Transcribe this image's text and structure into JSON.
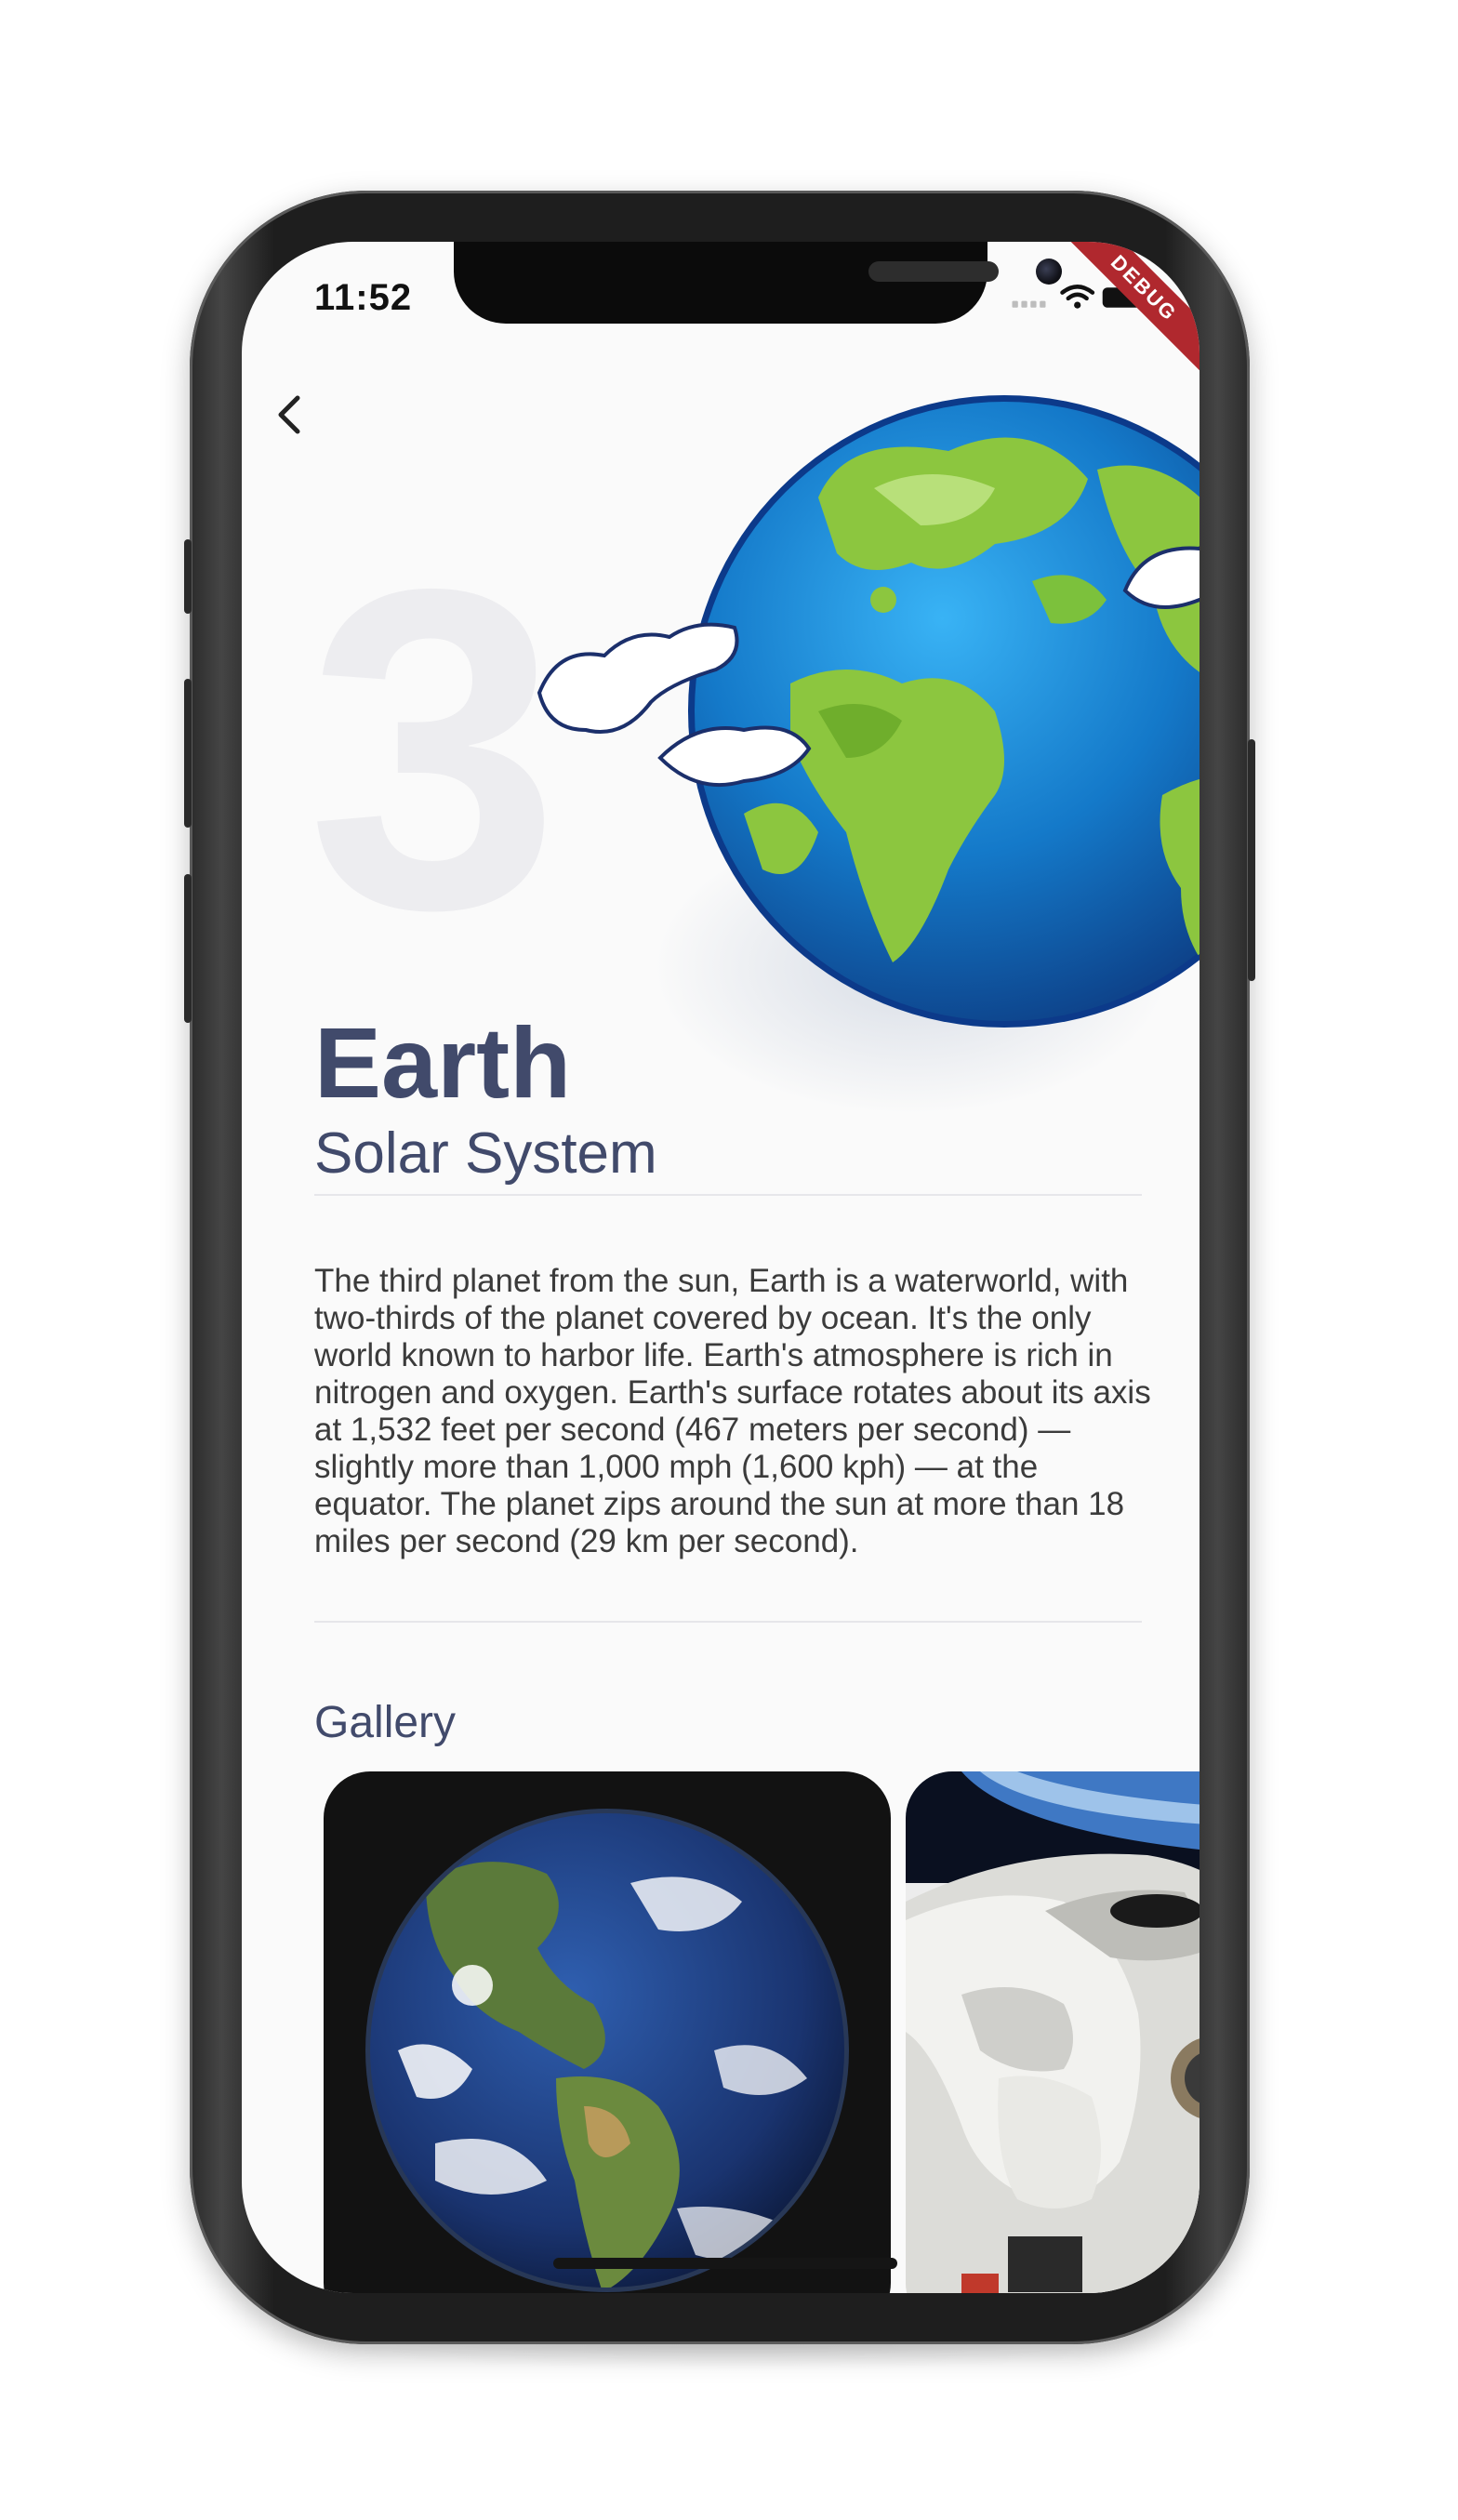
{
  "status_bar": {
    "time": "11:52",
    "debug_banner": "DEBUG"
  },
  "planet": {
    "position_number": "3",
    "name": "Earth",
    "system": "Solar System",
    "description": "The third planet from the sun, Earth is a waterworld, with two-thirds of the planet covered by ocean. It's the only world known to harbor life. Earth's atmosphere is rich in nitrogen and oxygen. Earth's surface rotates about its axis at 1,532 feet per second (467 meters per second) — slightly more than 1,000 mph (1,600 kph) — at the equator. The planet zips around the sun at more than 18 miles per second (29 km per second)."
  },
  "gallery": {
    "label": "Gallery",
    "items": [
      {
        "name": "earth-from-space-photo"
      },
      {
        "name": "astronaut-spacewalk-photo"
      }
    ]
  },
  "colors": {
    "title": "#414a6b",
    "background": "#fafafa",
    "ocean": "#1e88d8",
    "land": "#8cc63f",
    "debug_ribbon": "#b0282e"
  }
}
